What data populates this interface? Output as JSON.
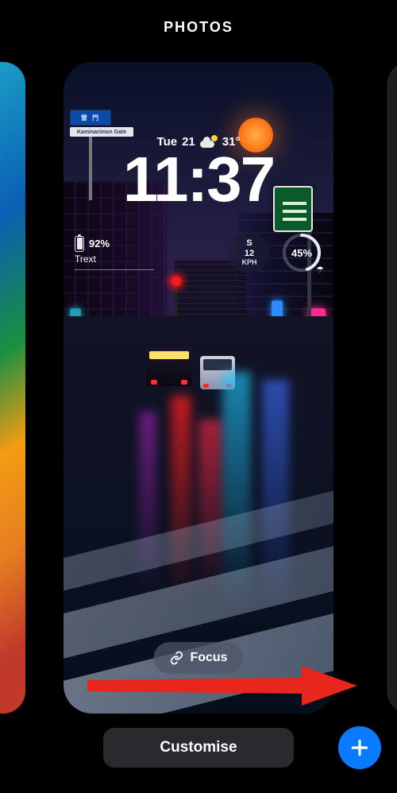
{
  "header": {
    "title": "PHOTOS"
  },
  "lockscreen": {
    "date_prefix": "Tue",
    "date_day": "21",
    "temp": "31°",
    "time": "11:37",
    "battery_percent": "92%",
    "battery_label": "Trext",
    "wind": {
      "dir": "S",
      "speed": "12",
      "unit": "KPH"
    },
    "ring_percent": "45%",
    "sign_top": "雷  門",
    "sign_bottom": "Kaminarimon Gate",
    "focus_label": "Focus"
  },
  "buttons": {
    "customise": "Customise"
  },
  "colors": {
    "accent_blue": "#0a7aff",
    "arrow_red": "#e8261c"
  }
}
